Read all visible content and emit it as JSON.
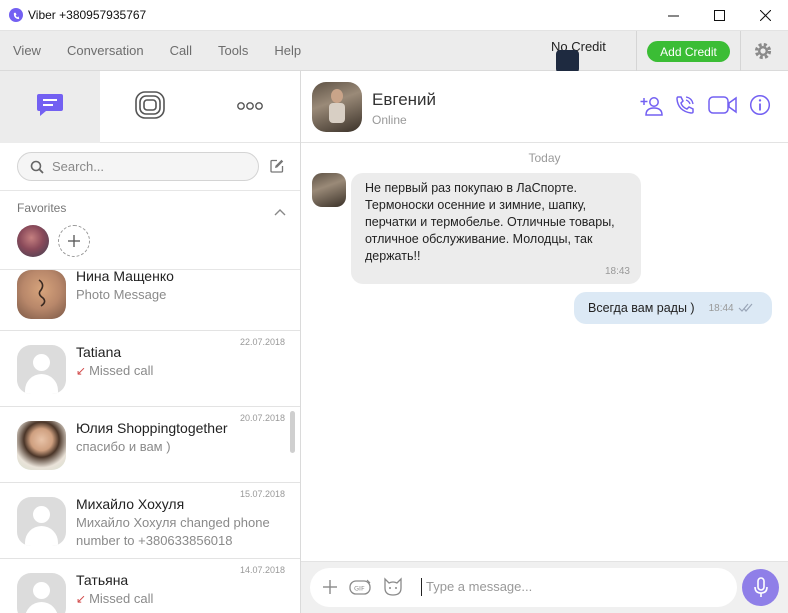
{
  "window": {
    "title": "Viber +380957935767"
  },
  "menu": {
    "items": [
      "View",
      "Conversation",
      "Call",
      "Tools",
      "Help"
    ]
  },
  "account": {
    "credit_label": "No Credit",
    "add_credit_label": "Add Credit"
  },
  "search": {
    "placeholder": "Search..."
  },
  "favorites": {
    "label": "Favorites"
  },
  "chats": [
    {
      "name": "Нина Мащенко",
      "subtitle": "Photo Message",
      "date": ""
    },
    {
      "name": "Tatiana",
      "subtitle": "Missed call",
      "date": "22.07.2018",
      "missed": true
    },
    {
      "name": "Юлия Shoppingtogether",
      "subtitle": "спасибо и вам )",
      "date": "20.07.2018"
    },
    {
      "name": "Михайло Хохуля",
      "subtitle": "Михайло Хохуля changed phone number to +380633856018",
      "date": "15.07.2018"
    },
    {
      "name": "Татьяна",
      "subtitle": "Missed call",
      "date": "14.07.2018",
      "missed": true
    }
  ],
  "conversation": {
    "name": "Евгений",
    "status": "Online",
    "day_label": "Today",
    "messages": [
      {
        "direction": "in",
        "text": "Не первый раз покупаю в ЛаСпорте.\nТермоноски  осенние и зимние, шапку,\nперчатки и термобелье. Отличные товары,\nотличное обслуживание. Молодцы, так\nдержать!!",
        "time": "18:43"
      },
      {
        "direction": "out",
        "text": "Всегда вам рады )",
        "time": "18:44"
      }
    ],
    "input_placeholder": "Type a message..."
  },
  "colors": {
    "accent": "#7360f2",
    "add_credit": "#3bbd35",
    "missed": "#d24a4a",
    "out_bubble": "#dce9f5"
  },
  "icons": [
    "viber-logo-icon",
    "minimize-icon",
    "maximize-icon",
    "close-icon",
    "gear-icon",
    "chats-icon",
    "stories-icon",
    "more-icon",
    "search-icon",
    "compose-icon",
    "chevron-up-icon",
    "add-participant-icon",
    "call-icon",
    "video-call-icon",
    "info-icon",
    "add-attachment-icon",
    "gif-icon",
    "sticker-icon",
    "microphone-icon"
  ]
}
